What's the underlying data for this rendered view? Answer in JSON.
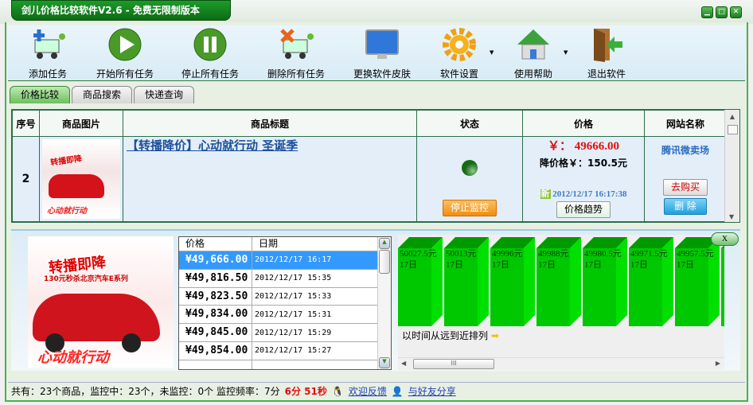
{
  "window": {
    "title": "剑儿价格比较软件V2.6  -  免费无限制版本"
  },
  "toolbar": [
    {
      "label": "添加任务",
      "icon": "cart-add-icon"
    },
    {
      "label": "开始所有任务",
      "icon": "play-icon"
    },
    {
      "label": "停止所有任务",
      "icon": "pause-icon"
    },
    {
      "label": "删除所有任务",
      "icon": "cart-delete-icon"
    },
    {
      "label": "更换软件皮肤",
      "icon": "monitor-icon"
    },
    {
      "label": "软件设置",
      "icon": "gear-icon"
    },
    {
      "label": "使用帮助",
      "icon": "home-icon"
    },
    {
      "label": "退出软件",
      "icon": "exit-door-icon"
    }
  ],
  "tabs": [
    "价格比较",
    "商品搜索",
    "快递查询"
  ],
  "grid": {
    "headers": [
      "序号",
      "商品图片",
      "商品标题",
      "状态",
      "价格",
      "网站名称"
    ],
    "row": {
      "index": "2",
      "title": "【转播降价】心动就行动 圣诞季",
      "stop_label": "停止监控",
      "price": "￥： 49666.00",
      "drop": "降价格￥：150.5元",
      "new_badge": "新",
      "time": "2012/12/17 16:17:38",
      "trend_label": "价格趋势",
      "site": "腾讯微卖场",
      "buy_label": "去购买",
      "delete_label": "删 除"
    },
    "image_text": [
      "转播即降",
      "130元秒杀北京汽车E系列",
      "心动就行动"
    ]
  },
  "history": {
    "headers": [
      "价格",
      "日期"
    ],
    "rows": [
      {
        "price": "¥49,666.00",
        "date": "2012/12/17 16:17"
      },
      {
        "price": "¥49,816.50",
        "date": "2012/12/17 15:35"
      },
      {
        "price": "¥49,823.50",
        "date": "2012/12/17 15:33"
      },
      {
        "price": "¥49,834.00",
        "date": "2012/12/17 15:31"
      },
      {
        "price": "¥49,845.00",
        "date": "2012/12/17 15:29"
      },
      {
        "price": "¥49,854.00",
        "date": "2012/12/17 15:27"
      }
    ]
  },
  "bars": {
    "items": [
      {
        "price": "50027.5元",
        "day": "17日"
      },
      {
        "price": "50013元",
        "day": "17日"
      },
      {
        "price": "49996元",
        "day": "17日"
      },
      {
        "price": "49988元",
        "day": "17日"
      },
      {
        "price": "49980.5元",
        "day": "17日"
      },
      {
        "price": "49971.5元",
        "day": "17日"
      },
      {
        "price": "49957.5元",
        "day": "17日"
      }
    ],
    "note": "以时间从远到近排列",
    "close_label": "X"
  },
  "status": {
    "summary": "共有：23个商品，监控中：23个，未监控：0个  监控频率：7分",
    "countdown": "6分 51秒",
    "feedback": "欢迎反馈",
    "share": "与好友分享"
  }
}
